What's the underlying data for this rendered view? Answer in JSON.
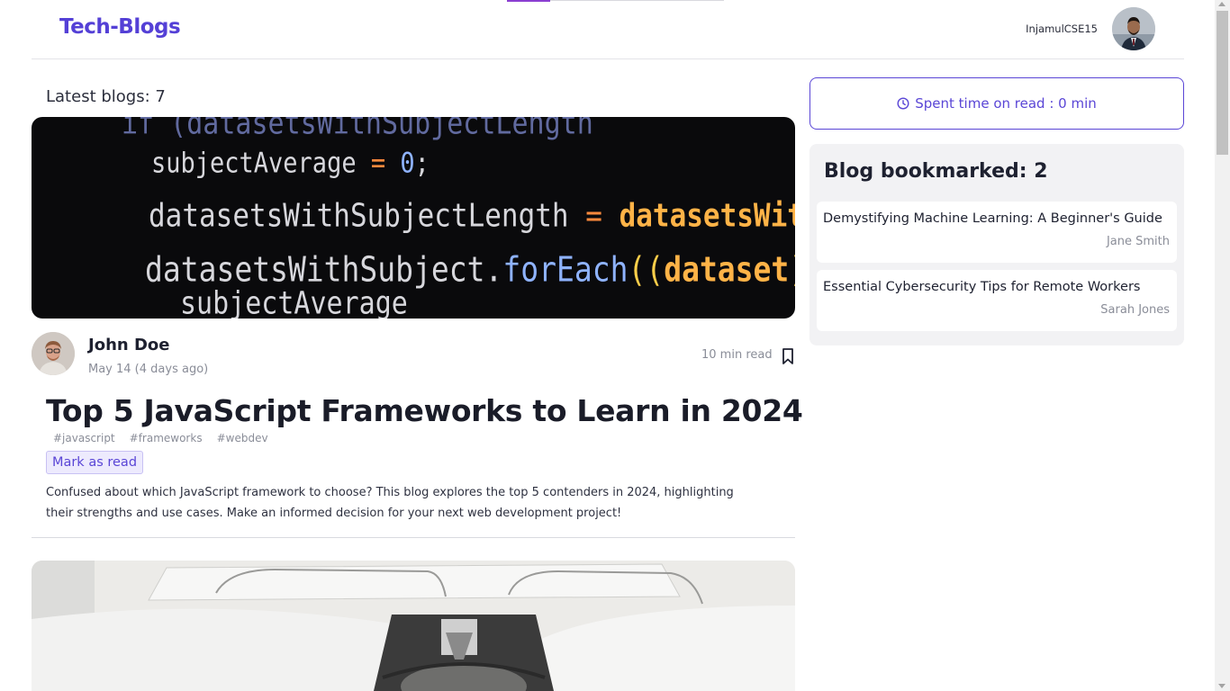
{
  "navbar": {
    "brand": "Tech-Blogs",
    "username": "InjamulCSE15",
    "avatar_icon": "user-avatar"
  },
  "progress": {
    "fraction": 0.2
  },
  "scroll": {
    "position_fraction": 0.0
  },
  "feed": {
    "latest_label": "Latest blogs: 7"
  },
  "post1": {
    "cover_icon": "code-screenshot-image",
    "cover_code": {
      "line1": "if (datasetsWithSubjectLength",
      "line2_var": "subjectAverage",
      "line2_op": " = ",
      "line2_val": "0",
      "line2_end": ";",
      "line3_var": "datasetsWithSubjectLength",
      "line3_op": " = ",
      "line3_val": "datasetsWithSu",
      "line4_var": "datasetsWithSubject",
      "line4_dot": ".",
      "line4_fn": "forEach",
      "line4_paren": "((",
      "line4_arg": "dataset",
      "line4_close": ")",
      "line4_arrow": " => {",
      "line5": "subjectAverage"
    },
    "author": "John Doe",
    "date": "May 14 (4 days ago)",
    "read_time": "10 min read",
    "title": "Top 5 JavaScript Frameworks to Learn in 2024",
    "tags": [
      "#javascript",
      "#frameworks",
      "#webdev"
    ],
    "mark_read_label": "Mark as read",
    "excerpt": "Confused about which JavaScript framework to choose? This blog explores the top 5 contenders in 2024, highlighting their strengths and use cases. Make an informed decision for your next web development project!"
  },
  "post2": {
    "cover_icon": "typewriter-image"
  },
  "sidebar": {
    "spent_time": "Spent time on read : 0 min",
    "bookmarks_title": "Blog bookmarked: 2",
    "bookmarks": [
      {
        "title": "Demystifying Machine Learning: A Beginner's Guide",
        "author": "Jane Smith"
      },
      {
        "title": "Essential Cybersecurity Tips for Remote Workers",
        "author": "Sarah Jones"
      }
    ]
  },
  "colors": {
    "brand": "#5440d6",
    "accent": "#5a46d6",
    "progress": "#8b3fd1"
  }
}
